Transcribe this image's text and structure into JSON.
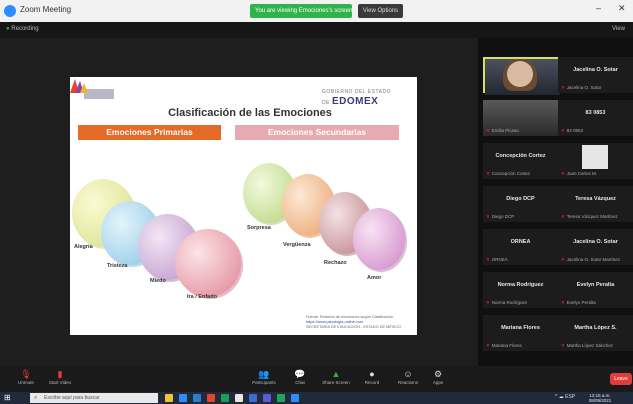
{
  "window": {
    "title": "Zoom Meeting",
    "share_banner": "You are viewing Emociones's screen",
    "view_options": "View Options",
    "minimize": "–",
    "close": "✕"
  },
  "meeting": {
    "info": "Recording",
    "view": "View"
  },
  "slide": {
    "brand_right": "EDOMEX",
    "brand_right_pre": "GOBIERNO DEL ESTADO DE",
    "title": "Clasificación de las Emociones",
    "header_primary": "Emociones Primarias",
    "header_secondary": "Emociones Secundarias",
    "primary": [
      "Alegría",
      "Tristeza",
      "Miedo",
      "Ira / Enfado"
    ],
    "secondary": [
      "Sorpresa",
      "Vergüenza",
      "Rechazo",
      "Amor"
    ],
    "footer_line1": "Fuente: Relación de emociones según Clasificación",
    "footer_line2": "https://www.psicologia-online.com",
    "footer_line3": "SECRETARÍA DE EDUCACIÓN - ESTADO DE MÉXICO"
  },
  "participants": [
    {
      "name": "",
      "sub": "",
      "type": "video"
    },
    {
      "name": "Jacelina O. Sotar",
      "sub": "Jacelina O. Sotar",
      "type": "name"
    },
    {
      "name": "",
      "sub": "Emilia Picaso",
      "type": "video2"
    },
    {
      "name": "83 0853",
      "sub": "83 0853",
      "type": "name"
    },
    {
      "name": "Concepción Cortez",
      "sub": "Concepción Cortez",
      "type": "name"
    },
    {
      "name": "",
      "sub": "Juan Carlos M.",
      "type": "image"
    },
    {
      "name": "Diego DCP",
      "sub": "Diego DCP",
      "type": "name"
    },
    {
      "name": "Teresa Vázquez",
      "sub": "Teresa Vázquez Martínez",
      "type": "name"
    },
    {
      "name": "ORNEA",
      "sub": "ORNEA",
      "type": "name"
    },
    {
      "name": "Jacelina O. Sotar",
      "sub": "Jacelina O. Sotar Martínez",
      "type": "name"
    },
    {
      "name": "Norma Rodríguez",
      "sub": "Norma Rodríguez",
      "type": "name"
    },
    {
      "name": "Evelyn Peralta",
      "sub": "Evelyn Peralta",
      "type": "name"
    },
    {
      "name": "Mariana Flores",
      "sub": "Mariana Flores",
      "type": "name"
    },
    {
      "name": "Martha López S.",
      "sub": "Martha López Sánchez",
      "type": "name"
    }
  ],
  "toolbar": {
    "mute": "Unmute",
    "video": "Start Video",
    "participants": "Participants",
    "chat": "Chat",
    "share": "Share Screen",
    "record": "Record",
    "reactions": "Reactions",
    "apps": "Apps",
    "end": "Leave"
  },
  "taskbar": {
    "search_placeholder": "Escribe aquí para buscar",
    "time": "12:16 a.m.",
    "date": "08/09/2021",
    "tray": "^ ☁ ESP"
  },
  "colors": {
    "primary_header": "#e46a28",
    "secondary_header": "#e7aab1",
    "zoom_blue": "#2d8cff",
    "share_green": "#2fb34a"
  }
}
